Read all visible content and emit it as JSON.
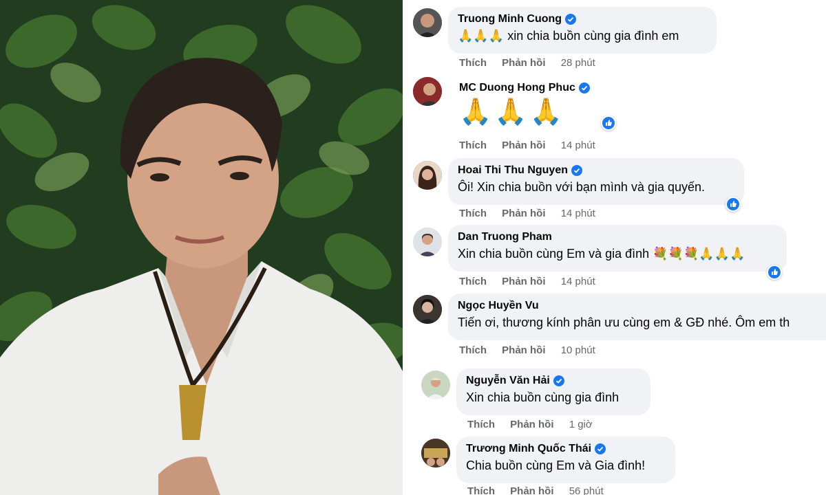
{
  "comments": [
    {
      "author": "Truong Minh Cuong",
      "text": "🙏🙏🙏 xin chia buồn cùng gia đình em",
      "like": "Thích",
      "reply": "Phản hồi",
      "time": "28 phút",
      "verified": true
    },
    {
      "author": "MC Duong Hong Phuc",
      "text": "🙏🙏🙏",
      "like": "Thích",
      "reply": "Phản hồi",
      "time": "14 phút",
      "verified": true,
      "reaction": "like"
    },
    {
      "author": "Hoai Thi Thu Nguyen",
      "text": "Ôi! Xin chia buồn với bạn mình và gia quyến.",
      "like": "Thích",
      "reply": "Phản hồi",
      "time": "14 phút",
      "verified": true,
      "reaction": "like"
    },
    {
      "author": "Dan Truong Pham",
      "text": "Xin chia buồn cùng Em và gia đình 💐💐💐🙏🙏🙏",
      "like": "Thích",
      "reply": "Phản hồi",
      "time": "14 phút",
      "verified": false,
      "reaction": "like"
    },
    {
      "author": "Ngọc Huyền Vu",
      "text": "Tiến ơi, thương kính phân ưu cùng em & GĐ nhé. Ôm em th",
      "like": "Thích",
      "reply": "Phản hồi",
      "time": "10 phút",
      "verified": false
    },
    {
      "author": "Nguyễn Văn Hải",
      "text": "Xin chia buồn cùng gia đình",
      "like": "Thích",
      "reply": "Phản hồi",
      "time": "1 giờ",
      "verified": true
    },
    {
      "author": "Trương Minh Quốc Thái",
      "text": "Chia buồn cùng Em và Gia đình!",
      "like": "Thích",
      "reply": "Phản hồi",
      "time": "56 phút",
      "verified": true
    }
  ],
  "colors": {
    "bubble": "#f0f2f5",
    "verified": "#1877f2",
    "meta": "#65676b",
    "text": "#050505"
  },
  "icons": {
    "verified": "verified-badge-icon",
    "reaction": "like-reaction-icon"
  }
}
